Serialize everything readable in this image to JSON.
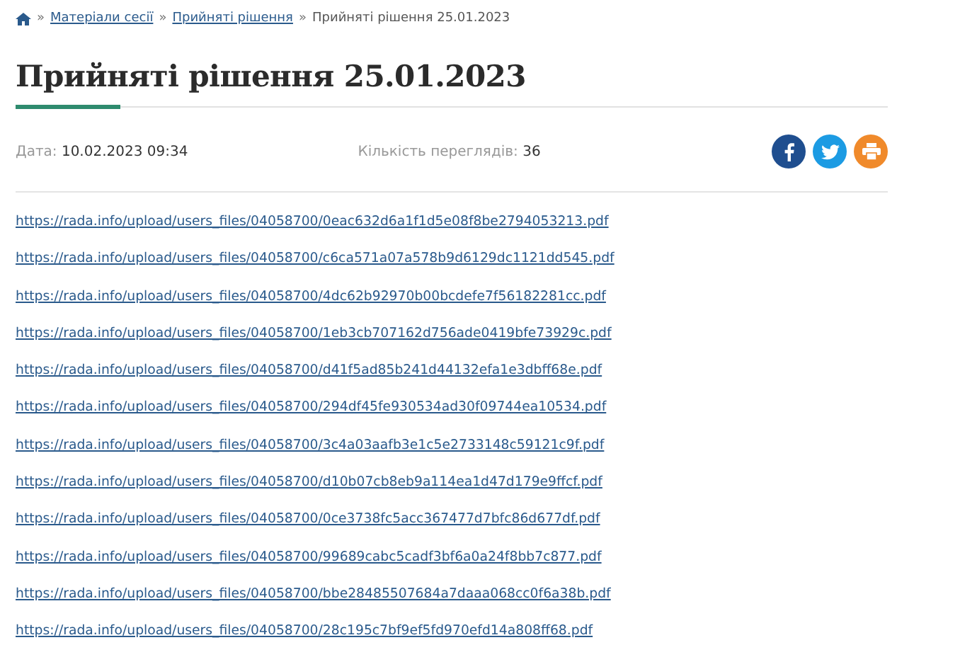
{
  "breadcrumb_separator": "»",
  "breadcrumb": [
    {
      "label": "Матеріали сесії",
      "kind": "link"
    },
    {
      "label": "Прийняті рішення",
      "kind": "link"
    },
    {
      "label": "Прийняті рішення 25.01.2023",
      "kind": "current"
    }
  ],
  "title": "Прийняті рішення 25.01.2023",
  "meta": {
    "date_label": "Дата:",
    "date": "10.02.2023 09:34",
    "views_label": "Кількість переглядів:",
    "views": "36"
  },
  "share": [
    {
      "kind": "facebook",
      "color": "#1f4e8f"
    },
    {
      "kind": "twitter",
      "color": "#1c9be3"
    },
    {
      "kind": "print",
      "color": "#f08a2b"
    }
  ],
  "links": [
    "https://rada.info/upload/users_files/04058700/0eac632d6a1f1d5e08f8be2794053213.pdf",
    "https://rada.info/upload/users_files/04058700/c6ca571a07a578b9d6129dc1121dd545.pdf",
    "https://rada.info/upload/users_files/04058700/4dc62b92970b00bcdefe7f56182281cc.pdf",
    "https://rada.info/upload/users_files/04058700/1eb3cb707162d756ade0419bfe73929c.pdf",
    "https://rada.info/upload/users_files/04058700/d41f5ad85b241d44132efa1e3dbff68e.pdf",
    "https://rada.info/upload/users_files/04058700/294df45fe930534ad30f09744ea10534.pdf",
    "https://rada.info/upload/users_files/04058700/3c4a03aafb3e1c5e2733148c59121c9f.pdf",
    "https://rada.info/upload/users_files/04058700/d10b07cb8eb9a114ea1d47d179e9ffcf.pdf",
    "https://rada.info/upload/users_files/04058700/0ce3738fc5acc367477d7bfc86d677df.pdf",
    "https://rada.info/upload/users_files/04058700/99689cabc5cadf3bf6a0a24f8bb7c877.pdf",
    "https://rada.info/upload/users_files/04058700/bbe28485507684a7daaa068cc0f6a38b.pdf",
    "https://rada.info/upload/users_files/04058700/28c195c7bf9ef5fd970efd14a808ff68.pdf"
  ]
}
